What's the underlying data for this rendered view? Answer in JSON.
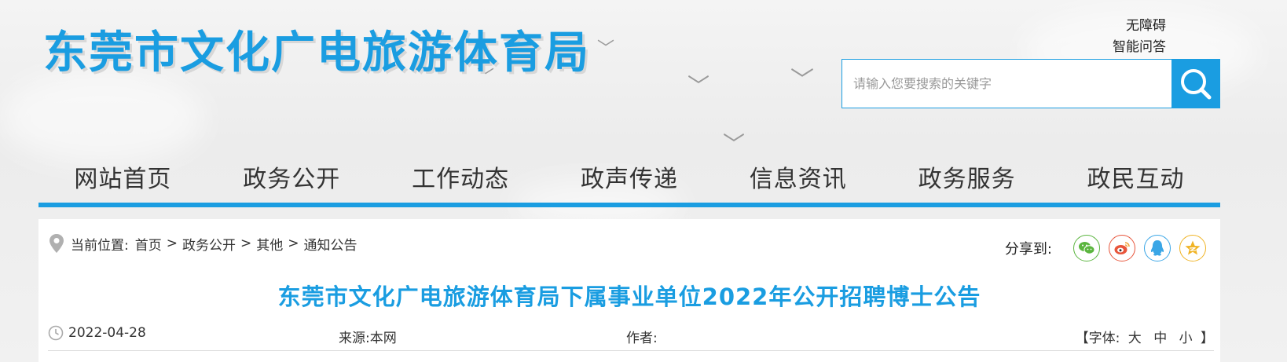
{
  "header": {
    "site_title": "东莞市文化广电旅游体育局",
    "accessibility_link": "无障碍",
    "smart_qa_link": "智能问答"
  },
  "search": {
    "placeholder": "请输入您要搜索的关键字"
  },
  "nav": {
    "items": [
      "网站首页",
      "政务公开",
      "工作动态",
      "政声传递",
      "信息资讯",
      "政务服务",
      "政民互动"
    ]
  },
  "breadcrumb": {
    "label": "当前位置:",
    "items": [
      "首页",
      "政务公开",
      "其他",
      "通知公告"
    ],
    "separator": ">"
  },
  "share": {
    "label": "分享到:",
    "icons": [
      "wechat-icon",
      "weibo-icon",
      "qq-icon",
      "qzone-icon"
    ],
    "colors": [
      "#5bb53f",
      "#e8553b",
      "#3aa6e6",
      "#f0b324"
    ]
  },
  "article": {
    "title": "东莞市文化广电旅游体育局下属事业单位2022年公开招聘博士公告",
    "date": "2022-04-28",
    "source": "来源:本网",
    "author": "作者:",
    "font_size_open": "【字体:",
    "font_size_options": [
      "大",
      "中",
      "小"
    ],
    "font_size_close": "】"
  },
  "colors": {
    "accent": "#1a9de1"
  }
}
